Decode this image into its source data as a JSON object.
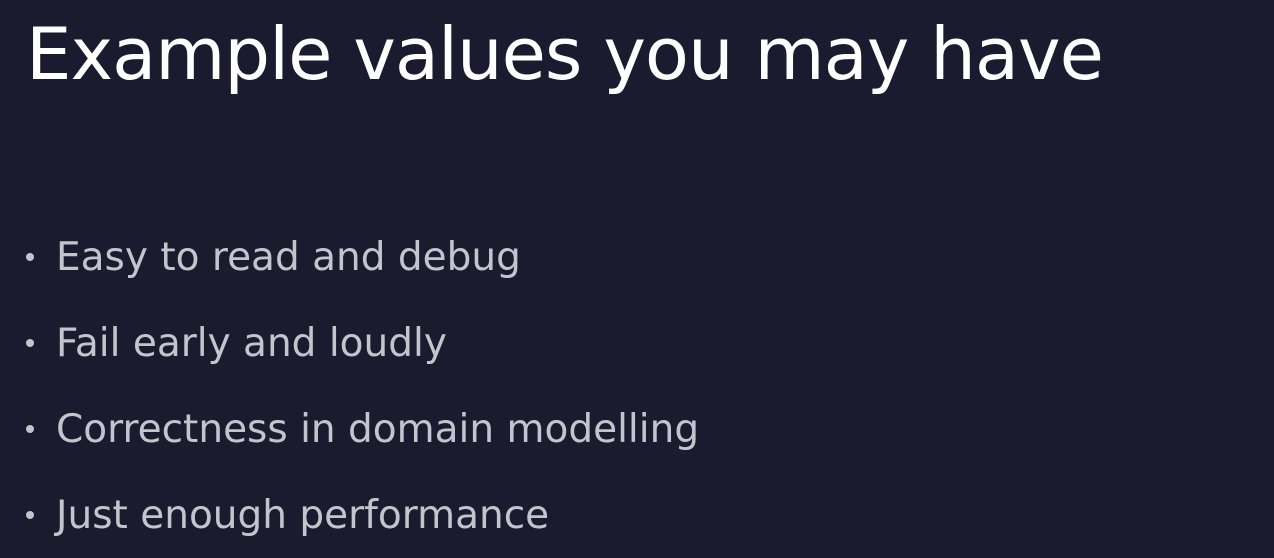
{
  "slide": {
    "title": "Example values you may have",
    "bullets": [
      "Easy to read and debug",
      "Fail early and loudly",
      "Correctness in domain modelling",
      "Just enough performance"
    ],
    "colors": {
      "background": "#1b1b2f",
      "title": "#ffffff",
      "bullet_text": "#c3c4cc"
    }
  }
}
